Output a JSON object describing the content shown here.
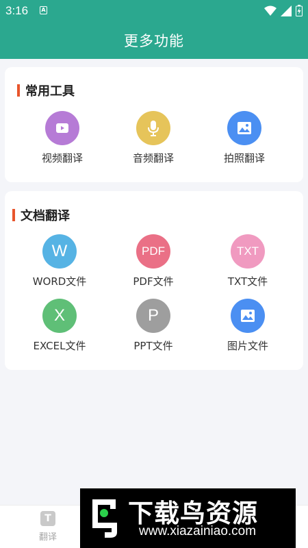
{
  "status_bar": {
    "time": "3:16",
    "sim_label": "A"
  },
  "header": {
    "title": "更多功能"
  },
  "sections": [
    {
      "title": "常用工具",
      "items": [
        {
          "label": "视频翻译",
          "icon": "video-icon",
          "color": "#b67bd6"
        },
        {
          "label": "音频翻译",
          "icon": "microphone-icon",
          "color": "#e6c45a"
        },
        {
          "label": "拍照翻译",
          "icon": "image-icon",
          "color": "#4b8ff2"
        }
      ]
    },
    {
      "title": "文档翻译",
      "items": [
        {
          "label": "WORD文件",
          "glyph": "W",
          "icon": "word-icon",
          "color": "#56b3e4"
        },
        {
          "label": "PDF文件",
          "glyph": "PDF",
          "icon": "pdf-icon",
          "color": "#ea7086"
        },
        {
          "label": "TXT文件",
          "glyph": "TXT",
          "icon": "txt-icon",
          "color": "#f09ac0"
        },
        {
          "label": "EXCEL文件",
          "glyph": "X",
          "icon": "excel-icon",
          "color": "#5fbf77"
        },
        {
          "label": "PPT文件",
          "glyph": "P",
          "icon": "ppt-icon",
          "color": "#9e9e9e"
        },
        {
          "label": "图片文件",
          "icon": "image-icon",
          "color": "#4b8ff2"
        }
      ]
    }
  ],
  "bottom_nav": {
    "tab_label": "翻译",
    "tab_glyph": "T"
  },
  "watermark": {
    "title": "下载鸟资源",
    "url": "www.xiazainiao.com"
  },
  "colors": {
    "primary": "#2ba88f",
    "section_accent": "#e8552c"
  }
}
